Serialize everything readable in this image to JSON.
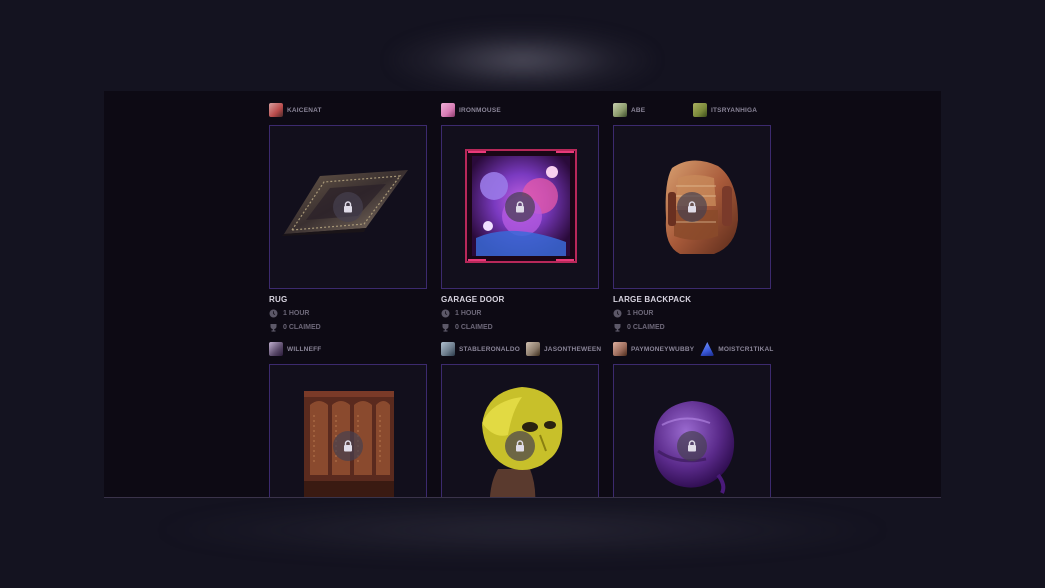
{
  "cards": [
    {
      "creators": [
        {
          "name": "KAICENAT",
          "avatar_color": "#b84a4a"
        }
      ],
      "title": "RUG",
      "duration": "1 HOUR",
      "claimed": "0 CLAIMED",
      "item_icon": "rug-icon"
    },
    {
      "creators": [
        {
          "name": "IRONMOUSE",
          "avatar_color": "#d67bb4"
        }
      ],
      "title": "GARAGE DOOR",
      "duration": "1 HOUR",
      "claimed": "0 CLAIMED",
      "item_icon": "garage-door-icon"
    },
    {
      "creators": [
        {
          "name": "ABE",
          "avatar_color": "#8a9a6a"
        },
        {
          "name": "ITSRYANHIGA",
          "avatar_color": "#7a8a3a"
        }
      ],
      "title": "LARGE BACKPACK",
      "duration": "1 HOUR",
      "claimed": "0 CLAIMED",
      "item_icon": "backpack-icon"
    },
    {
      "creators": [
        {
          "name": "WILLNEFF",
          "avatar_color": "#5a4a6a"
        }
      ],
      "item_icon": "wardrobe-icon"
    },
    {
      "creators": [
        {
          "name": "STABLERONALDO",
          "avatar_color": "#6a7a8a"
        },
        {
          "name": "JASONTHEWEEN",
          "avatar_color": "#8a7a6a"
        }
      ],
      "item_icon": "mask-icon"
    },
    {
      "creators": [
        {
          "name": "PAYMONEYWUBBY",
          "avatar_color": "#9a6a5a"
        },
        {
          "name": "MOISTCR1TIKAL",
          "avatar_color": "#3a5adb"
        }
      ],
      "item_icon": "durag-icon"
    }
  ]
}
